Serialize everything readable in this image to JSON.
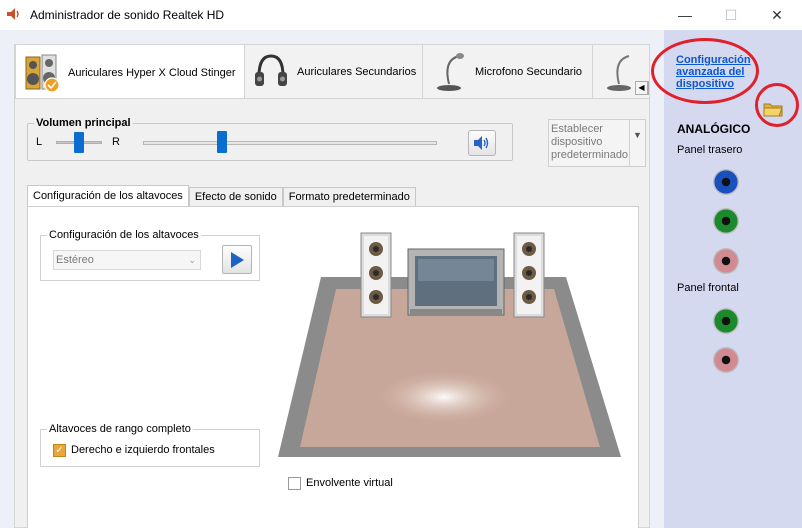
{
  "window": {
    "title": "Administrador de sonido Realtek HD",
    "controls": {
      "minimize": "—",
      "maximize": "☐",
      "close": "✕"
    }
  },
  "device_tabs": [
    {
      "label": "Auriculares Hyper X Cloud Stinger",
      "icon": "speaker-icon",
      "active": true
    },
    {
      "label": "Auriculares Secundarios",
      "icon": "headphones-icon",
      "active": false
    },
    {
      "label": "Microfono Secundario",
      "icon": "microphone-icon",
      "active": false
    }
  ],
  "volume": {
    "legend": "Volumen principal",
    "left_label": "L",
    "right_label": "R",
    "balance_fraction": 0.5,
    "level_fraction": 0.27
  },
  "default_device": {
    "text": "Establecer dispositivo predeterminado"
  },
  "inner_tabs": [
    {
      "label": "Configuración de los altavoces",
      "active": true
    },
    {
      "label": "Efecto de sonido",
      "active": false
    },
    {
      "label": "Formato predeterminado",
      "active": false
    }
  ],
  "speaker_config": {
    "legend": "Configuración de los altavoces",
    "selected": "Estéreo"
  },
  "full_range": {
    "legend": "Altavoces de rango completo",
    "option_label": "Derecho e izquierdo frontales",
    "checked": true
  },
  "virtual_surround": {
    "label": "Envolvente virtual",
    "checked": false
  },
  "side": {
    "advanced_link": "Configuración avanzada del dispositivo",
    "analog_title": "ANALÓGICO",
    "rear_panel": "Panel trasero",
    "front_panel": "Panel frontal",
    "rear_jacks": [
      "#1a4fbf",
      "#1b8a2c",
      "#d28a92"
    ],
    "front_jacks": [
      "#1b8a2c",
      "#d28a92"
    ]
  }
}
